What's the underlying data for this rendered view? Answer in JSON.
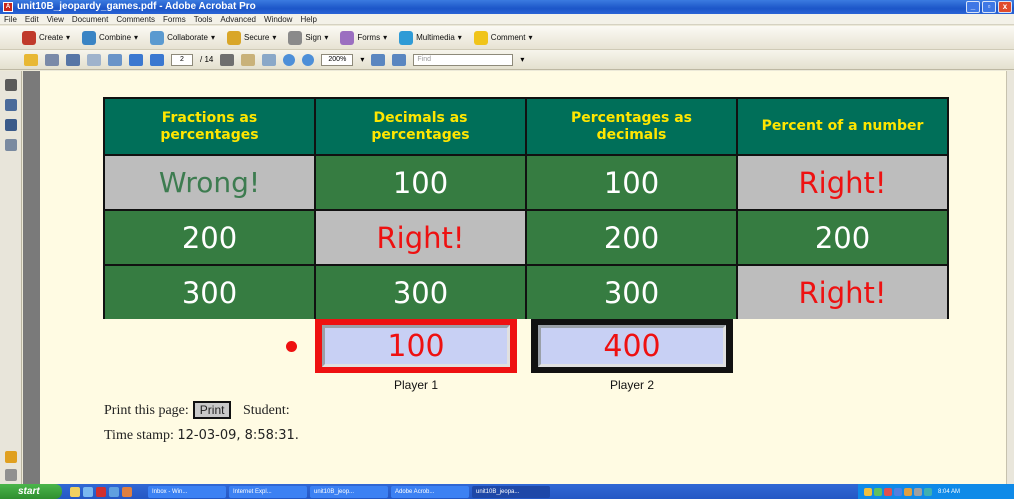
{
  "window": {
    "title": "unit10B_jeopardy_games.pdf - Adobe Acrobat Pro",
    "minimize_label": "_",
    "restore_label": "▫",
    "close_label": "x"
  },
  "menu": [
    "File",
    "Edit",
    "View",
    "Document",
    "Comments",
    "Forms",
    "Tools",
    "Advanced",
    "Window",
    "Help"
  ],
  "toolbar": {
    "create": "Create",
    "combine": "Combine",
    "collaborate": "Collaborate",
    "secure": "Secure",
    "sign": "Sign",
    "forms": "Forms",
    "multimedia": "Multimedia",
    "comment": "Comment"
  },
  "nav": {
    "page_current": "2",
    "page_total": "/ 14",
    "zoom": "200%",
    "find_placeholder": "Find"
  },
  "game": {
    "headers": [
      "Fractions as percentages",
      "Decimals as percentages",
      "Percentages as decimals",
      "Percent of a number"
    ],
    "rows": [
      [
        {
          "text": "Wrong!",
          "state": "wrong"
        },
        {
          "text": "100",
          "state": "open"
        },
        {
          "text": "100",
          "state": "open"
        },
        {
          "text": "Right!",
          "state": "right"
        }
      ],
      [
        {
          "text": "200",
          "state": "open"
        },
        {
          "text": "Right!",
          "state": "right"
        },
        {
          "text": "200",
          "state": "open"
        },
        {
          "text": "200",
          "state": "open"
        }
      ],
      [
        {
          "text": "300",
          "state": "open"
        },
        {
          "text": "300",
          "state": "open"
        },
        {
          "text": "300",
          "state": "open"
        },
        {
          "text": "Right!",
          "state": "right"
        }
      ]
    ],
    "player1": {
      "score": "100",
      "label": "Player 1"
    },
    "player2": {
      "score": "400",
      "label": "Player 2"
    },
    "print_label": "Print this page:",
    "print_button": "Print",
    "student_label": "Student:",
    "timestamp_label": "Time stamp:",
    "timestamp_value": "12-03-09,  8:58:31."
  },
  "taskbar": {
    "start": "start",
    "tasks": [
      "Inbox - Win...",
      "Internet Expl...",
      "unit10B_jeop...",
      "Adobe Acrob...",
      "unit10B_jeopa..."
    ],
    "clock": "8:04 AM"
  },
  "colors": {
    "header_bg": "#006f59",
    "header_text": "#ffe600",
    "open_cell": "#367c41",
    "answered_cell": "#bdbdbd",
    "right_text": "#ee1111",
    "page_bg": "#fffbe3"
  }
}
